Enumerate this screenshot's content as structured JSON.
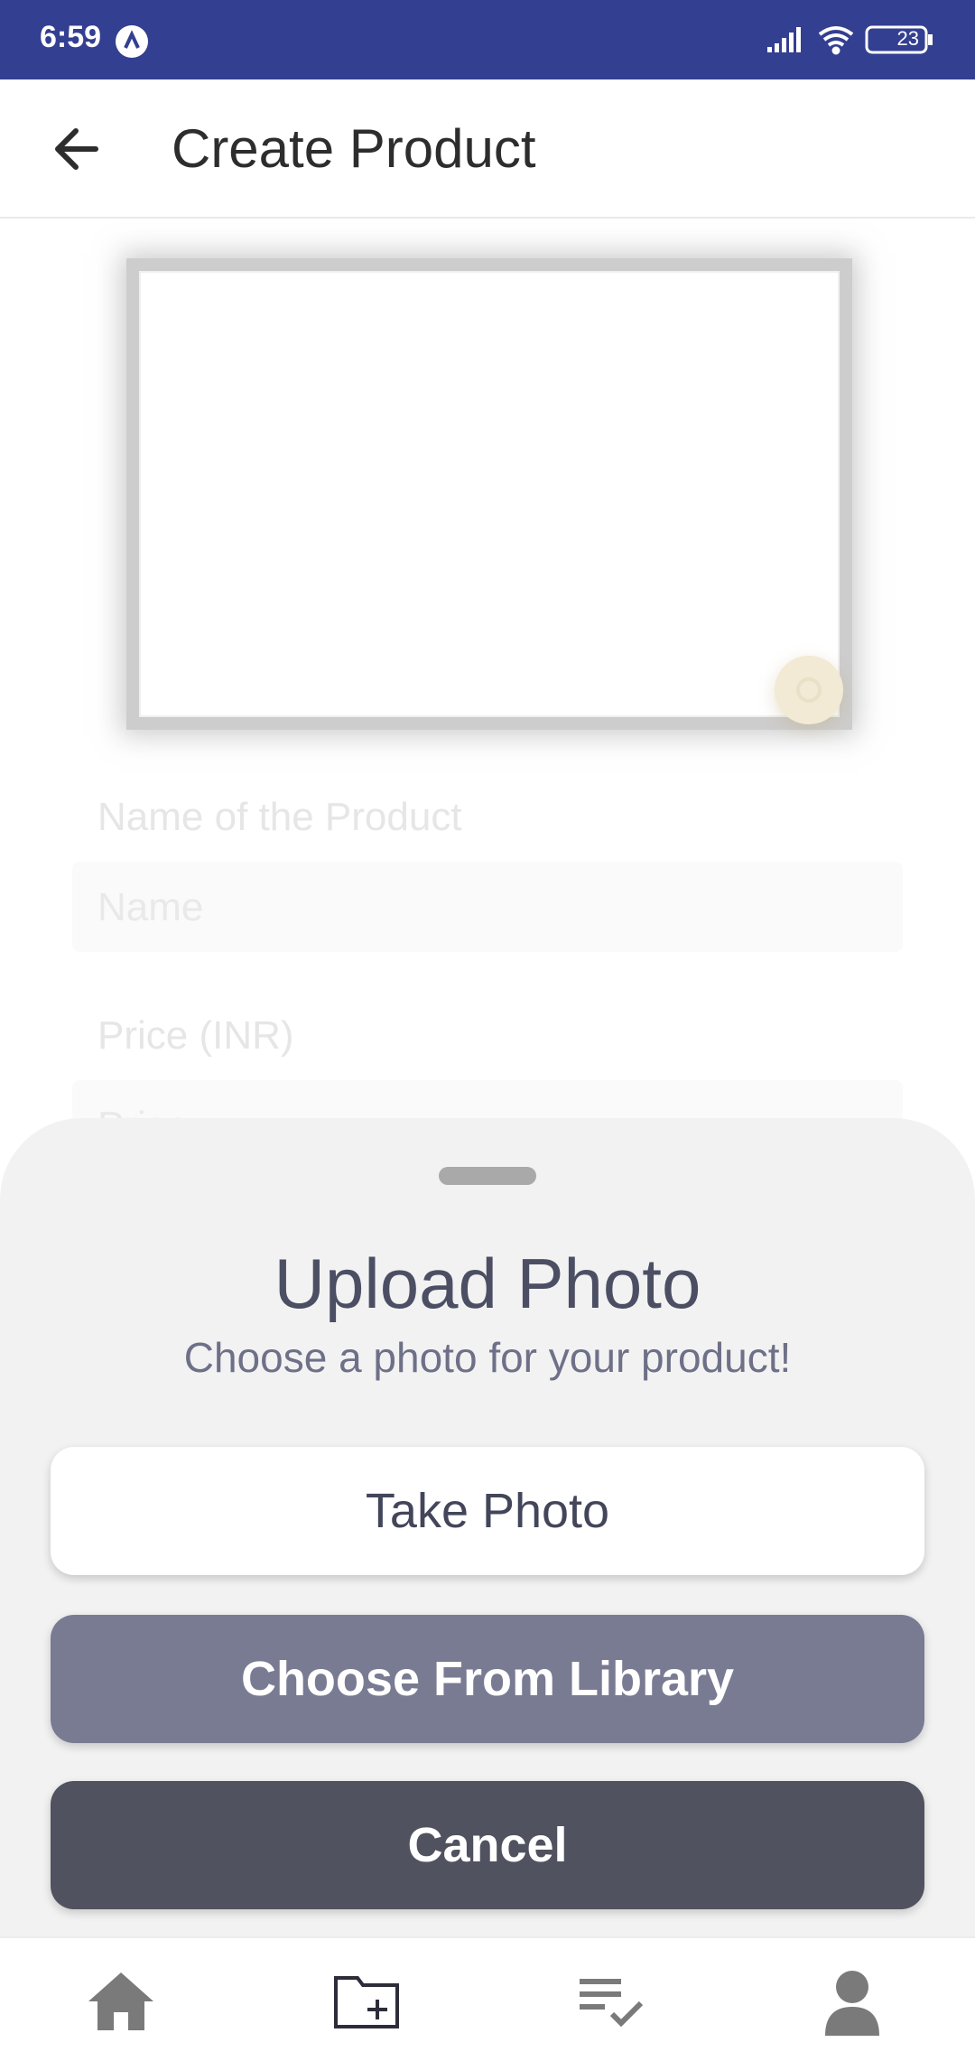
{
  "status_bar": {
    "time": "6:59",
    "battery": "23",
    "icons": [
      "app-notification-icon",
      "signal-icon",
      "wifi-icon",
      "battery-icon"
    ]
  },
  "app_bar": {
    "title": "Create Product",
    "back_icon": "arrow-back-icon"
  },
  "form": {
    "name_label": "Name of the Product",
    "name_placeholder": "Name",
    "price_label": "Price (INR)",
    "price_placeholder": "Price"
  },
  "bottom_sheet": {
    "title": "Upload Photo",
    "subtitle": "Choose a photo for your product!",
    "take_photo_label": "Take Photo",
    "library_label": "Choose From Library",
    "cancel_label": "Cancel"
  },
  "bottom_nav": {
    "items": [
      "home-icon",
      "add-folder-icon",
      "checklist-icon",
      "profile-icon"
    ]
  },
  "colors": {
    "status_bar": "#333f91",
    "sheet_background": "#f2f2f2",
    "library_button": "#797b93",
    "cancel_button": "#50525f"
  }
}
